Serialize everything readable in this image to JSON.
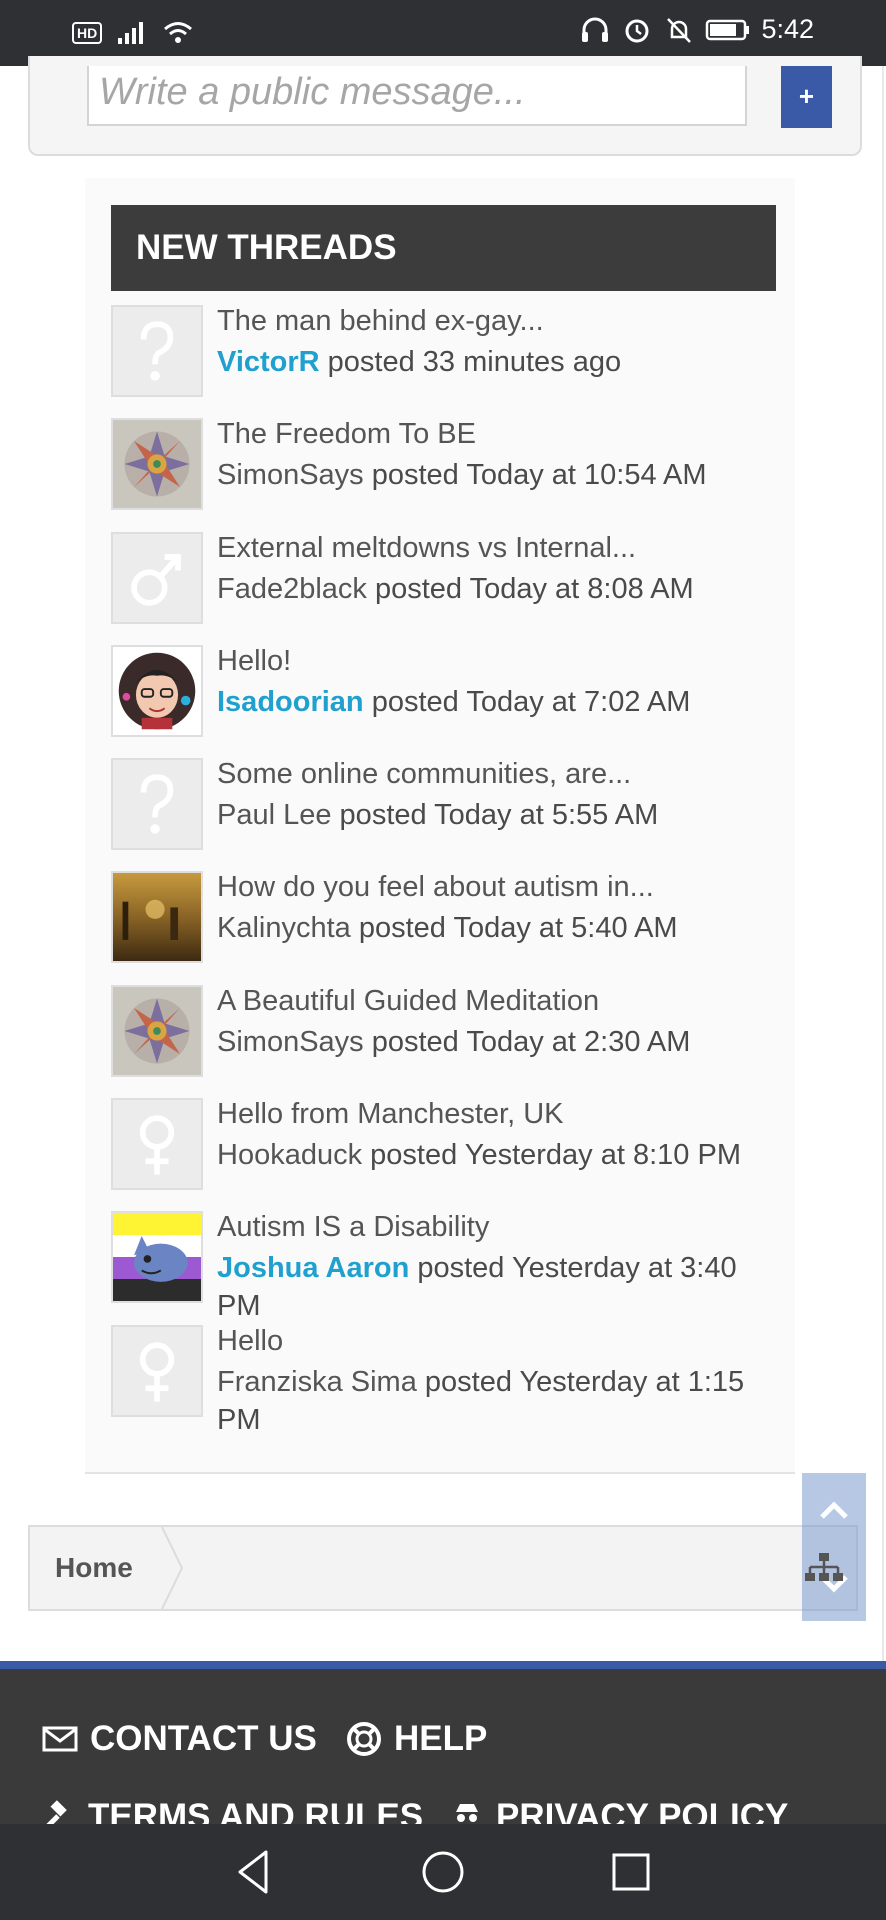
{
  "status_bar": {
    "hd": "HD",
    "time": "5:42"
  },
  "message_box": {
    "placeholder": "Write a public message...",
    "add_label": "+"
  },
  "new_threads": {
    "heading": "NEW THREADS",
    "items": [
      {
        "title": "The man behind ex-gay...",
        "author": "VictorR",
        "verb": " posted ",
        "time": "33 minutes ago",
        "avatar": "question-mark-icon",
        "author_link": true
      },
      {
        "title": "The Freedom To BE",
        "author": "SimonSays",
        "verb": " posted ",
        "time": "Today at 10:54 AM",
        "avatar": "mandala-avatar",
        "author_link": false
      },
      {
        "title": "External meltdowns vs Internal...",
        "author": "Fade2black",
        "verb": " posted ",
        "time": "Today at 8:08 AM",
        "avatar": "male-symbol-icon",
        "author_link": false
      },
      {
        "title": "Hello!",
        "author": "Isadoorian",
        "verb": " posted ",
        "time": "Today at 7:02 AM",
        "avatar": "cartoon-portrait-avatar",
        "author_link": true
      },
      {
        "title": "Some online communities, are...",
        "author": "Paul Lee",
        "verb": " posted ",
        "time": "Today at 5:55 AM",
        "avatar": "question-mark-icon",
        "author_link": false
      },
      {
        "title": "How do you feel about autism in...",
        "author": "Kalinychta",
        "verb": " posted ",
        "time": "Today at 5:40 AM",
        "avatar": "painting-avatar",
        "author_link": false
      },
      {
        "title": "A Beautiful Guided Meditation",
        "author": "SimonSays",
        "verb": " posted ",
        "time": "Today at 2:30 AM",
        "avatar": "mandala-avatar",
        "author_link": false
      },
      {
        "title": "Hello from Manchester, UK",
        "author": "Hookaduck",
        "verb": " posted ",
        "time": "Yesterday at 8:10 PM",
        "avatar": "female-symbol-icon",
        "author_link": false
      },
      {
        "title": "Autism IS a Disability",
        "author": "Joshua Aaron",
        "verb": " posted ",
        "time": "Yesterday at 3:40 PM",
        "avatar": "flag-creature-avatar",
        "author_link": true
      },
      {
        "title": "Hello",
        "author": "Franziska Sima",
        "verb": " posted ",
        "time": "Yesterday at 1:15 PM",
        "avatar": "female-symbol-icon",
        "author_link": false
      }
    ]
  },
  "breadcrumb": {
    "home": "Home"
  },
  "footer": {
    "contact": "CONTACT US",
    "help": "HELP",
    "terms": "TERMS AND RULES",
    "privacy": "PRIVACY POLICY"
  },
  "colors": {
    "accent": "#3a5aa8",
    "link": "#1fa0cf",
    "header_bg": "#3c3c3c",
    "footer_bg": "#3a3a3a"
  }
}
